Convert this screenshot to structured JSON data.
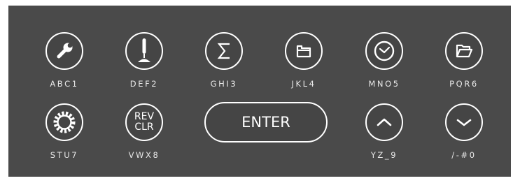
{
  "keypad": {
    "row1": [
      {
        "label": "ABC1",
        "icon": "wrench-icon"
      },
      {
        "label": "DEF2",
        "icon": "joystick-icon"
      },
      {
        "label": "GHI3",
        "icon": "sigma-icon"
      },
      {
        "label": "JKL4",
        "icon": "folder-tab-icon"
      },
      {
        "label": "MNO5",
        "icon": "clock-icon"
      },
      {
        "label": "PQR6",
        "icon": "open-folder-icon"
      }
    ],
    "row2": [
      {
        "label": "STU7",
        "icon": "gear-icon"
      },
      {
        "label": "VWX8",
        "text_top": "REV",
        "text_bottom": "CLR"
      },
      {
        "label": "YZ_9",
        "icon": "chevron-up-icon"
      },
      {
        "label": "/-#0",
        "icon": "chevron-down-icon"
      }
    ],
    "enter_label": "ENTER"
  },
  "colors": {
    "panel": "#4a4a4a",
    "button_fill": "#454545",
    "stroke": "#ffffff",
    "label": "#e8e8e8"
  }
}
